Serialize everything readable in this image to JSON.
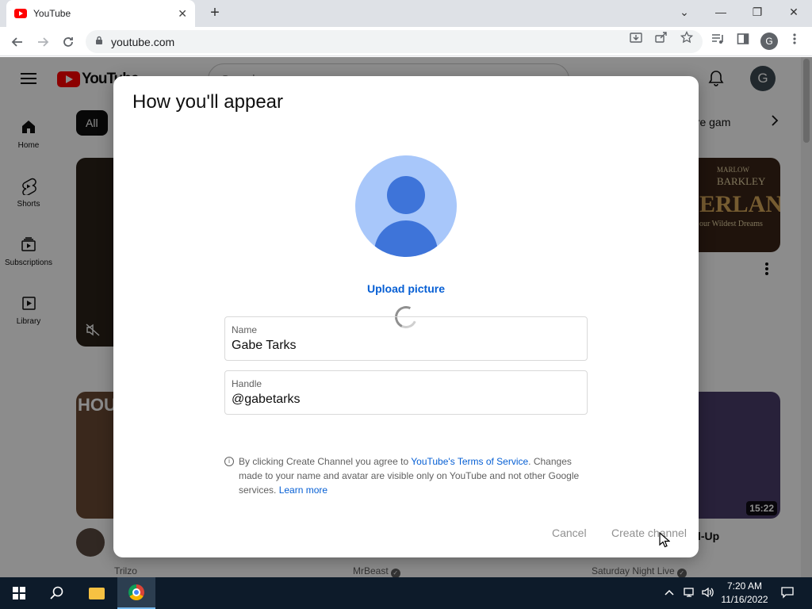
{
  "browser": {
    "tab_title": "YouTube",
    "tab_close": "✕",
    "new_tab": "+",
    "url": "youtube.com",
    "window_controls": {
      "dropdown": "⌄",
      "minimize": "—",
      "restore": "❐",
      "close": "✕"
    }
  },
  "youtube": {
    "logo_text": "YouTube",
    "search_placeholder": "Search",
    "avatar_letter": "G",
    "sidebar": [
      {
        "label": "Home",
        "icon": "home-icon"
      },
      {
        "label": "Shorts",
        "icon": "shorts-icon"
      },
      {
        "label": "Subscriptions",
        "icon": "subscriptions-icon"
      },
      {
        "label": "Library",
        "icon": "library-icon"
      }
    ],
    "chips": {
      "all": "All",
      "right_partial": "ure gam"
    },
    "thumb_right_top": {
      "line1": "MARLOW",
      "line2": "BARKLEY",
      "line3": "ERLAND",
      "line4": "our Wildest Dreams"
    },
    "thumb_left_bottom_text": "HOU",
    "duration": "15:22",
    "right_video_title_partial": "l-Up",
    "channels": [
      "Trilzo",
      "MrBeast",
      "Saturday Night Live"
    ]
  },
  "dialog": {
    "title": "How you'll appear",
    "upload_label": "Upload picture",
    "name_label": "Name",
    "name_value": "Gabe Tarks",
    "handle_label": "Handle",
    "handle_value": "@gabetarks",
    "info_prefix": "By clicking Create Channel you agree to ",
    "info_tos_link": "YouTube's Terms of Service",
    "info_middle": ". Changes made to your name and avatar are visible only on YouTube and not other Google services. ",
    "info_learn_link": "Learn more",
    "cancel_label": "Cancel",
    "create_label": "Create channel"
  },
  "taskbar": {
    "time": "7:20 AM",
    "date": "11/16/2022"
  }
}
